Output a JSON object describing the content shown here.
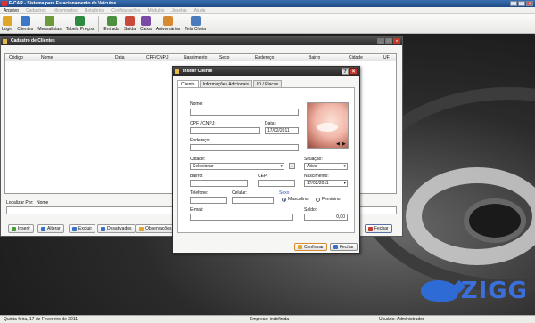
{
  "app": {
    "title": "E-CAR - Sistema para Estacionamento de Veículos",
    "controls": {
      "minimize": "_",
      "maximize": "□",
      "close": "×"
    }
  },
  "menubar": [
    "Arquivo",
    "Cadastros",
    "Movimentos",
    "Relatórios",
    "Configurações",
    "Módulos",
    "Janelas",
    "Ajuda"
  ],
  "toolbar": [
    {
      "label": "Login",
      "icon": "key-icon",
      "color": "#e0a52b"
    },
    {
      "label": "Clientes",
      "icon": "clients-icon",
      "color": "#3b76c9"
    },
    {
      "label": "Mensalistas",
      "icon": "monthly-icon",
      "color": "#6a9a3a"
    },
    {
      "label": "Tabela Preços",
      "icon": "price-table-icon",
      "color": "#2d8a3f"
    },
    {
      "label": "Entrada",
      "icon": "car-entry-icon",
      "color": "#4c8f3c"
    },
    {
      "label": "Saída",
      "icon": "car-exit-icon",
      "color": "#c94a3b"
    },
    {
      "label": "Caixa",
      "icon": "cashier-icon",
      "color": "#7a4aa6"
    },
    {
      "label": "Aniversários",
      "icon": "birthday-icon",
      "color": "#d6892e"
    },
    {
      "label": "Tela Cheia",
      "icon": "fullscreen-icon",
      "color": "#4b7bbd"
    }
  ],
  "cadastro": {
    "title": "Cadastro de Clientes",
    "columns": [
      "Código",
      "Nome",
      "Data",
      "CPF/CNPJ",
      "Nascimento",
      "Sexo",
      "Endereço",
      "Bairro",
      "Cidade",
      "UF"
    ],
    "filter": {
      "label": "Localizar Por:",
      "field": "Nome",
      "value": ""
    },
    "buttons": {
      "insert": "Inserir",
      "edit": "Alterar",
      "delete": "Excluir",
      "inactive": "Desativados",
      "notes": "Observações",
      "close": "Fechar"
    }
  },
  "dialog": {
    "title": "Inserir Cliente",
    "help": "?",
    "close": "×",
    "tabs": [
      "Cliente",
      "Informações Adicionais",
      "ID / Placas"
    ],
    "fields": {
      "nome": {
        "label": "Nome:",
        "value": ""
      },
      "cpf": {
        "label": "CPF / CNPJ:",
        "value": ""
      },
      "data": {
        "label": "Data:",
        "value": "17/02/2011"
      },
      "endereco": {
        "label": "Endereço:",
        "value": ""
      },
      "cidade": {
        "label": "Cidade:",
        "value": "Selecionar"
      },
      "situacao": {
        "label": "Situação:",
        "value": "Ativo"
      },
      "bairro": {
        "label": "Bairro:",
        "value": ""
      },
      "cep": {
        "label": "CEP:",
        "value": ""
      },
      "nascimento": {
        "label": "Nascimento:",
        "value": "17/02/2011"
      },
      "telefone": {
        "label": "Telefone:",
        "value": ""
      },
      "celular": {
        "label": "Celular:",
        "value": ""
      },
      "email": {
        "label": "E-mail:",
        "value": ""
      },
      "saldo": {
        "label": "Saldo:",
        "value": "0,00"
      }
    },
    "sexo": {
      "label": "Sexo",
      "options": [
        "Masculino",
        "Feminino"
      ],
      "selected": "Masculino"
    },
    "photo_arrows": {
      "left": "◀",
      "right": "▶"
    },
    "buttons": {
      "confirm": "Confirmar",
      "close": "Fechar"
    }
  },
  "statusbar": {
    "date": "Quinta-feira, 17 de Fevereiro de 2011",
    "company": "Empresa: indefinida",
    "user": "Usuário: Administrador"
  },
  "watermark": "ZIGG"
}
